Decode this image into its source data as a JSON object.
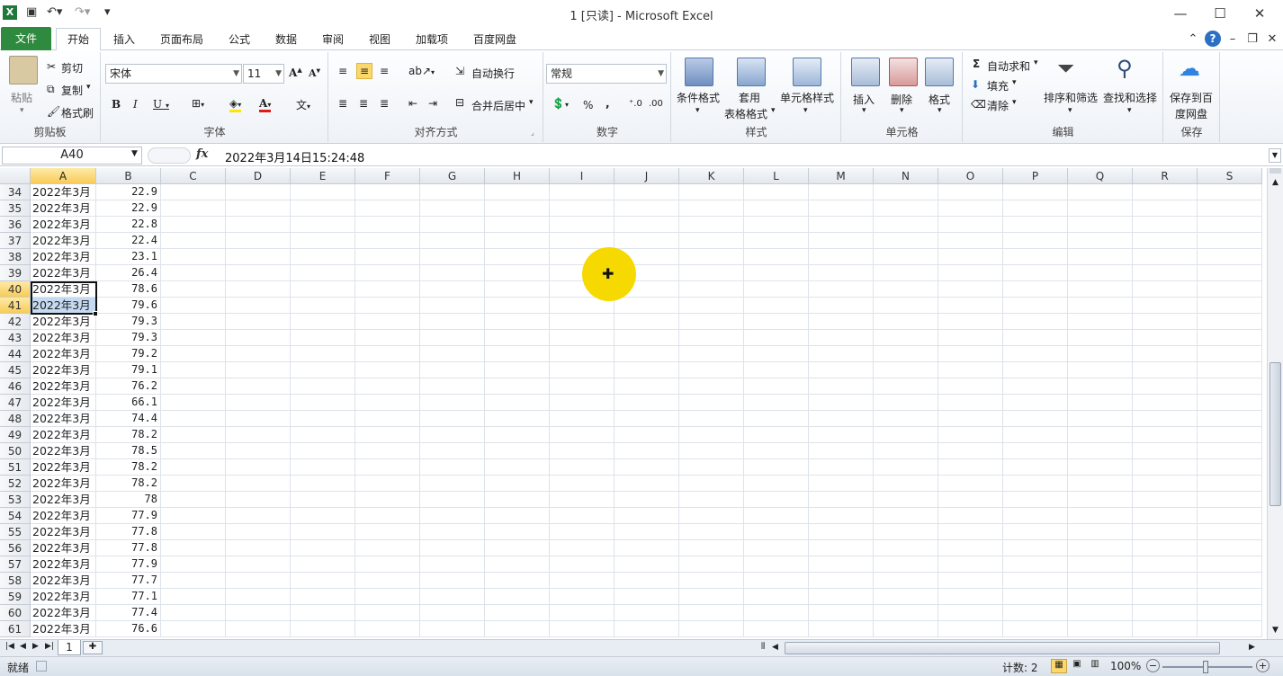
{
  "window": {
    "title": "1 [只读] - Microsoft Excel",
    "app_icon": "excel-icon"
  },
  "tabs": [
    "文件",
    "开始",
    "插入",
    "页面布局",
    "公式",
    "数据",
    "审阅",
    "视图",
    "加载项",
    "百度网盘"
  ],
  "ribbon": {
    "clipboard": {
      "label": "剪贴板",
      "paste": "粘贴",
      "cut": "剪切",
      "copy": "复制",
      "format_painter": "格式刷"
    },
    "font": {
      "label": "字体",
      "name": "宋体",
      "size": "11"
    },
    "alignment": {
      "label": "对齐方式",
      "wrap": "自动换行",
      "merge": "合并后居中"
    },
    "number": {
      "label": "数字",
      "format": "常规"
    },
    "styles": {
      "label": "样式",
      "conditional": "条件格式",
      "table1": "套用",
      "table2": "表格格式",
      "cell_styles": "单元格样式"
    },
    "cells": {
      "label": "单元格",
      "insert": "插入",
      "delete": "删除",
      "format": "格式"
    },
    "editing": {
      "label": "编辑",
      "autosum": "自动求和",
      "fill": "填充",
      "clear": "清除",
      "sort": "排序和筛选",
      "find": "查找和选择"
    },
    "save": {
      "label": "保存",
      "save1": "保存到百",
      "save2": "度网盘"
    }
  },
  "formula_bar": {
    "name_box": "A40",
    "fx": "fx",
    "content": "2022年3月14日15:24:48"
  },
  "columns": [
    "A",
    "B",
    "C",
    "D",
    "E",
    "F",
    "G",
    "H",
    "I",
    "J",
    "K",
    "L",
    "M",
    "N",
    "O",
    "P",
    "Q",
    "R",
    "S"
  ],
  "rows": [
    {
      "n": "34",
      "a": "2022年3月",
      "b": "22.9"
    },
    {
      "n": "35",
      "a": "2022年3月",
      "b": "22.9"
    },
    {
      "n": "36",
      "a": "2022年3月",
      "b": "22.8"
    },
    {
      "n": "37",
      "a": "2022年3月",
      "b": "22.4"
    },
    {
      "n": "38",
      "a": "2022年3月",
      "b": "23.1"
    },
    {
      "n": "39",
      "a": "2022年3月",
      "b": "26.4"
    },
    {
      "n": "40",
      "a": "2022年3月",
      "b": "78.6"
    },
    {
      "n": "41",
      "a": "2022年3月",
      "b": "79.6"
    },
    {
      "n": "42",
      "a": "2022年3月",
      "b": "79.3"
    },
    {
      "n": "43",
      "a": "2022年3月",
      "b": "79.3"
    },
    {
      "n": "44",
      "a": "2022年3月",
      "b": "79.2"
    },
    {
      "n": "45",
      "a": "2022年3月",
      "b": "79.1"
    },
    {
      "n": "46",
      "a": "2022年3月",
      "b": "76.2"
    },
    {
      "n": "47",
      "a": "2022年3月",
      "b": "66.1"
    },
    {
      "n": "48",
      "a": "2022年3月",
      "b": "74.4"
    },
    {
      "n": "49",
      "a": "2022年3月",
      "b": "78.2"
    },
    {
      "n": "50",
      "a": "2022年3月",
      "b": "78.5"
    },
    {
      "n": "51",
      "a": "2022年3月",
      "b": "78.2"
    },
    {
      "n": "52",
      "a": "2022年3月",
      "b": "78.2"
    },
    {
      "n": "53",
      "a": "2022年3月",
      "b": "78"
    },
    {
      "n": "54",
      "a": "2022年3月",
      "b": "77.9"
    },
    {
      "n": "55",
      "a": "2022年3月",
      "b": "77.8"
    },
    {
      "n": "56",
      "a": "2022年3月",
      "b": "77.8"
    },
    {
      "n": "57",
      "a": "2022年3月",
      "b": "77.9"
    },
    {
      "n": "58",
      "a": "2022年3月",
      "b": "77.7"
    },
    {
      "n": "59",
      "a": "2022年3月",
      "b": "77.1"
    },
    {
      "n": "60",
      "a": "2022年3月",
      "b": "77.4"
    },
    {
      "n": "61",
      "a": "2022年3月",
      "b": "76.6"
    }
  ],
  "selected_rows": [
    "40",
    "41"
  ],
  "sheet_tabs": [
    "1"
  ],
  "status": {
    "ready": "就绪",
    "count": "计数: 2",
    "zoom": "100%"
  }
}
